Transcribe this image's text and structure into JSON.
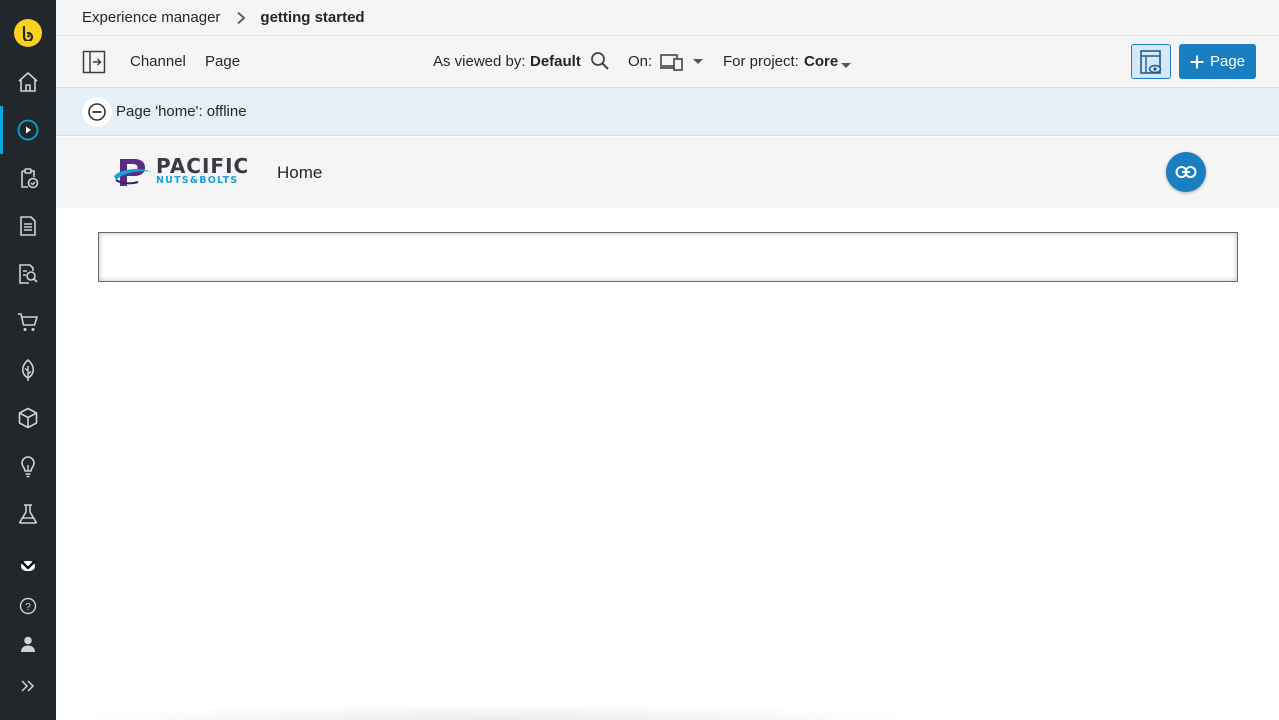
{
  "colors": {
    "sidebar_bg": "#22272b",
    "brand_yellow": "#fcd21f",
    "active_accent": "#0aa5da",
    "primary_blue": "#1a7fc1",
    "status_bg": "#e4eff7",
    "logo_blue": "#1d9fd8",
    "logo_purple": "#5a2d82"
  },
  "sidebar": {
    "logo_icon": "bloomreach-logo-icon",
    "items": [
      {
        "name": "home-icon"
      },
      {
        "name": "experience-manager-icon",
        "active": true
      },
      {
        "name": "projects-icon"
      },
      {
        "name": "content-icon"
      },
      {
        "name": "content-search-icon"
      },
      {
        "name": "commerce-cart-icon"
      },
      {
        "name": "seo-leaf-icon"
      },
      {
        "name": "setup-cube-icon"
      },
      {
        "name": "insights-bulb-icon"
      },
      {
        "name": "experiments-flask-icon"
      },
      {
        "name": "more-chevron-down-icon"
      }
    ],
    "bottom": [
      {
        "name": "help-icon"
      },
      {
        "name": "user-icon"
      },
      {
        "name": "expand-sidebar-icon"
      }
    ]
  },
  "breadcrumb": {
    "root": "Experience manager",
    "current": "getting started"
  },
  "toolbar": {
    "channel_label": "Channel",
    "page_label": "Page",
    "viewed_by_label": "As viewed by:",
    "viewed_by_value": "Default",
    "on_label": "On:",
    "project_label": "For project:",
    "project_value": "Core",
    "add_page_label": "Page"
  },
  "status": {
    "text": "Page 'home': offline"
  },
  "site": {
    "logo_word": "PACIFIC",
    "logo_sub": "NUTS&BOLTS",
    "nav_home": "Home"
  }
}
